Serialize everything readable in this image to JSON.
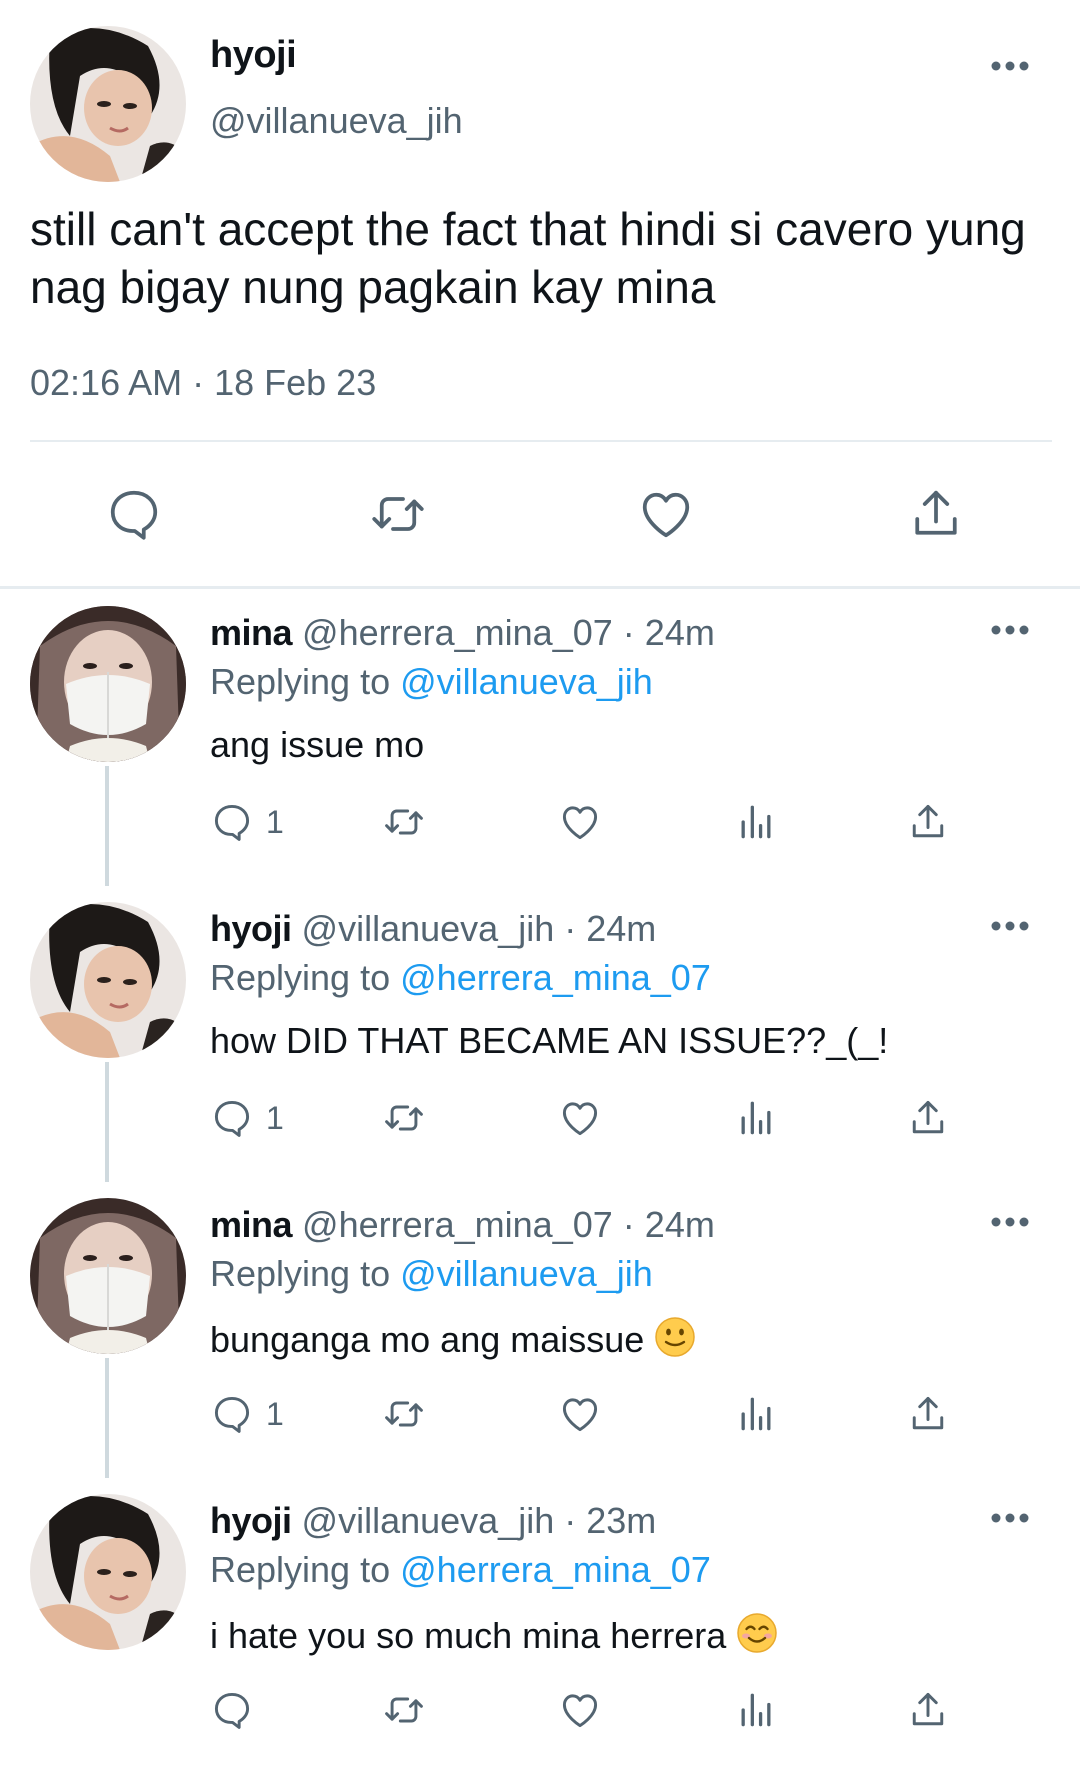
{
  "main_tweet": {
    "name": "hyoji",
    "handle": "@villanueva_jih",
    "text": "still can't accept the fact that hindi si cavero yung nag bigay nung pagkain kay mina",
    "timestamp": "02:16 AM · 18 Feb 23",
    "actions": [
      "reply-icon",
      "retweet-icon",
      "like-icon",
      "share-icon"
    ]
  },
  "replies": [
    {
      "name": "mina",
      "handle": "@herrera_mina_07",
      "separator": "·",
      "time": "24m",
      "replying_prefix": "Replying to",
      "replying_to": "@villanueva_jih",
      "text": "ang issue mo",
      "emoji": "",
      "reply_count": "1"
    },
    {
      "name": "hyoji",
      "handle": "@villanueva_jih",
      "separator": "·",
      "time": "24m",
      "replying_prefix": "Replying to",
      "replying_to": "@herrera_mina_07",
      "text": "how DID THAT BECAME AN ISSUE??_(_!",
      "emoji": "",
      "reply_count": "1"
    },
    {
      "name": "mina",
      "handle": "@herrera_mina_07",
      "separator": "·",
      "time": "24m",
      "replying_prefix": "Replying to",
      "replying_to": "@villanueva_jih",
      "text": "bunganga mo ang maissue",
      "emoji": "slightly-smiling-face",
      "reply_count": "1"
    },
    {
      "name": "hyoji",
      "handle": "@villanueva_jih",
      "separator": "·",
      "time": "23m",
      "replying_prefix": "Replying to",
      "replying_to": "@herrera_mina_07",
      "text": "i hate you so much mina herrera",
      "emoji": "smiling-face-with-smiling-eyes",
      "reply_count": ""
    }
  ],
  "colors": {
    "text": "#0f1419",
    "secondary": "#536471",
    "link": "#1d9bf0",
    "divider": "#e6ecf0",
    "thread_line": "#cfd9de"
  }
}
